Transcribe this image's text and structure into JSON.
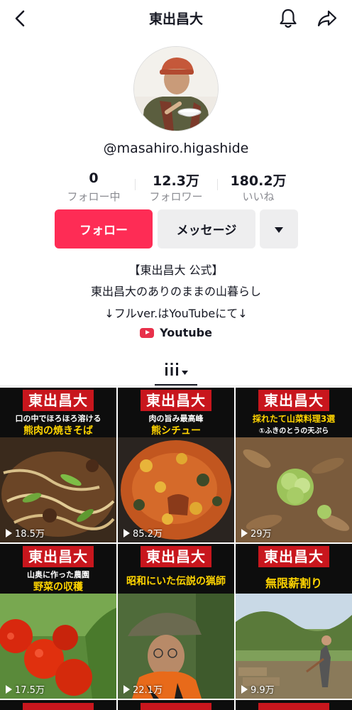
{
  "header": {
    "title": "東出昌大"
  },
  "profile": {
    "username": "@masahiro.higashide",
    "stats": [
      {
        "value": "0",
        "label": "フォロー中"
      },
      {
        "value": "12.3万",
        "label": "フォロワー"
      },
      {
        "value": "180.2万",
        "label": "いいね"
      }
    ],
    "follow_label": "フォロー",
    "message_label": "メッセージ",
    "bio": [
      "【東出昌大 公式】",
      "東出昌大のありのままの山暮らし",
      "↓フルver.はYouTubeにて↓"
    ],
    "link_label": "Youtube"
  },
  "videos": [
    {
      "brand": "東出昌大",
      "caption_top": "口の中でほろほろ溶ける",
      "caption_main": "熊肉の焼きそば",
      "views": "18.5万"
    },
    {
      "brand": "東出昌大",
      "caption_top": "肉の旨み最高峰",
      "caption_main": "熊シチュー",
      "views": "85.2万"
    },
    {
      "brand": "東出昌大",
      "caption_top": "採れたて山菜料理3選",
      "caption_main": "①ふきのとうの天ぷら",
      "views": "29万"
    },
    {
      "brand": "東出昌大",
      "caption_top": "山奥に作った農園",
      "caption_main": "野菜の収穫",
      "views": "17.5万"
    },
    {
      "brand": "東出昌大",
      "caption_top": "",
      "caption_main": "昭和にいた伝説の猟師",
      "views": "22.1万"
    },
    {
      "brand": "東出昌大",
      "caption_top": "",
      "caption_main": "無限薪割り",
      "views": "9.9万"
    }
  ],
  "colors": {
    "accent": "#fe2c55",
    "brand_red": "#c8161d",
    "caption_yellow": "#ffd400"
  }
}
